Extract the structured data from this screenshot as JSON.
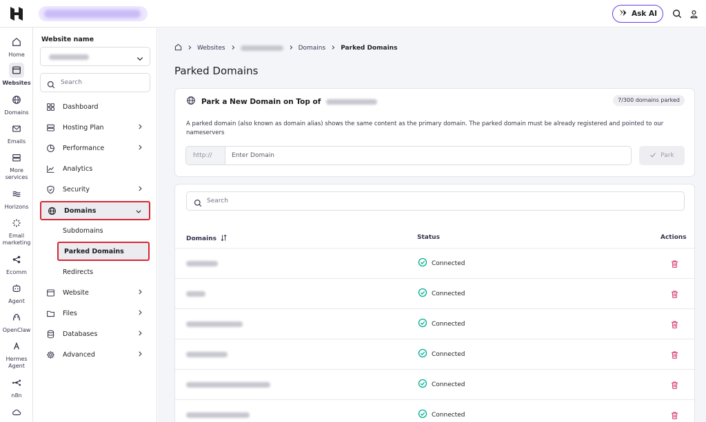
{
  "topbar": {
    "ask_ai_label": "Ask AI"
  },
  "rail": [
    {
      "label": "Home",
      "icon": "home-icon"
    },
    {
      "label": "Websites",
      "icon": "browser-icon"
    },
    {
      "label": "Domains",
      "icon": "globe-icon"
    },
    {
      "label": "Emails",
      "icon": "mail-icon"
    },
    {
      "label": "More services",
      "icon": "server-icon"
    },
    {
      "label": "Horizons",
      "icon": "horizons-icon"
    },
    {
      "label": "Email marketing",
      "icon": "sparkle-icon"
    },
    {
      "label": "Ecomm",
      "icon": "share-icon"
    },
    {
      "label": "Agent",
      "icon": "agent-icon"
    },
    {
      "label": "OpenClaw",
      "icon": "claw-icon"
    },
    {
      "label": "Hermes Agent",
      "icon": "hermes-icon"
    },
    {
      "label": "n8n",
      "icon": "n8n-icon"
    }
  ],
  "sidebar": {
    "title": "Website name",
    "search_placeholder": "Search",
    "items": [
      {
        "label": "Dashboard"
      },
      {
        "label": "Hosting Plan"
      },
      {
        "label": "Performance"
      },
      {
        "label": "Analytics"
      },
      {
        "label": "Security"
      },
      {
        "label": "Domains"
      },
      {
        "label": "Website"
      },
      {
        "label": "Files"
      },
      {
        "label": "Databases"
      },
      {
        "label": "Advanced"
      }
    ],
    "sub_items": [
      {
        "label": "Subdomains"
      },
      {
        "label": "Parked Domains"
      },
      {
        "label": "Redirects"
      }
    ]
  },
  "breadcrumb": {
    "websites": "Websites",
    "domains": "Domains",
    "current": "Parked Domains"
  },
  "page": {
    "title": "Parked Domains"
  },
  "park": {
    "heading": "Park a New Domain on Top of",
    "count_badge": "7/300 domains parked",
    "description": "A parked domain (also known as domain alias) shows the same content as the primary domain. The parked domain must be already registered and pointed to our nameservers",
    "prefix": "http://",
    "input_placeholder": "Enter Domain",
    "button_label": "Park"
  },
  "list": {
    "search_placeholder": "Search",
    "columns": {
      "domains": "Domains",
      "status": "Status",
      "actions": "Actions"
    },
    "rows": [
      {
        "status": "Connected"
      },
      {
        "status": "Connected"
      },
      {
        "status": "Connected"
      },
      {
        "status": "Connected"
      },
      {
        "status": "Connected"
      },
      {
        "status": "Connected"
      }
    ]
  },
  "colors": {
    "accent": "#673de6",
    "highlight_border": "#d6262f",
    "connected": "#00b090",
    "delete": "#d63163"
  }
}
